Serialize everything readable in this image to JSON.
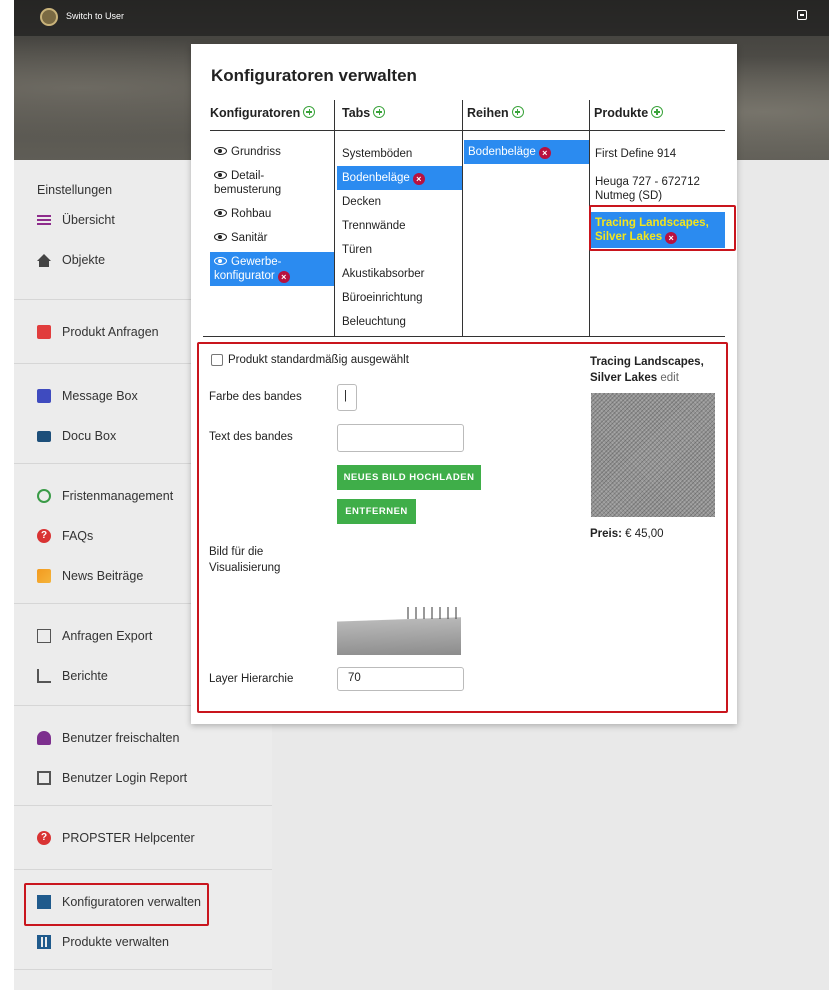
{
  "topbar": {
    "switch_label": "Switch to User"
  },
  "sidebar": {
    "settings_label": "Einstellungen",
    "groups": [
      [
        {
          "label": "Übersicht",
          "icon": "menu-icon"
        },
        {
          "label": "Objekte",
          "icon": "home-icon"
        }
      ],
      [
        {
          "label": "Produkt Anfragen",
          "icon": "list-icon"
        }
      ],
      [
        {
          "label": "Message Box",
          "icon": "message-icon"
        },
        {
          "label": "Docu Box",
          "icon": "folder-icon"
        }
      ],
      [
        {
          "label": "Fristenmanagement",
          "icon": "clock-icon"
        },
        {
          "label": "FAQs",
          "icon": "help-icon"
        },
        {
          "label": "News Beiträge",
          "icon": "rss-icon"
        }
      ],
      [
        {
          "label": "Anfragen Export",
          "icon": "export-icon"
        },
        {
          "label": "Berichte",
          "icon": "chart-icon"
        }
      ],
      [
        {
          "label": "Benutzer freischalten",
          "icon": "user-icon"
        },
        {
          "label": "Benutzer Login Report",
          "icon": "report-icon"
        }
      ],
      [
        {
          "label": "PROPSTER Helpcenter",
          "icon": "help-icon"
        }
      ],
      [
        {
          "label": "Konfiguratoren verwalten",
          "icon": "sitemap-icon"
        },
        {
          "label": "Produkte verwalten",
          "icon": "grid-icon"
        }
      ]
    ]
  },
  "panel": {
    "title": "Konfiguratoren verwalten",
    "columns": {
      "konfiguratoren": {
        "header": "Konfiguratoren",
        "items": [
          "Grundriss",
          "Detail-\nbemusterung",
          "Rohbau",
          "Sanitär",
          "Gewerbe-\nkonfigurator"
        ]
      },
      "tabs": {
        "header": "Tabs",
        "items": [
          "Systemböden",
          "Bodenbeläge",
          "Decken",
          "Trennwände",
          "Türen",
          "Akustikabsorber",
          "Büroeinrichtung",
          "Beleuchtung"
        ]
      },
      "reihen": {
        "header": "Reihen",
        "items": [
          "Bodenbeläge"
        ]
      },
      "produkte": {
        "header": "Produkte",
        "items": [
          "First Define 914",
          "Heuga 727 - 672712 Nutmeg (SD)",
          "Tracing Landscapes, Silver Lakes"
        ]
      }
    },
    "form": {
      "default_selected_label": "Produkt standardmäßig ausgewählt",
      "band_color_label": "Farbe des bandes",
      "band_color_value": "",
      "band_text_label": "Text des bandes",
      "band_text_value": "",
      "upload_button": "NEUES BILD HOCHLADEN",
      "remove_button": "ENTFERNEN",
      "visual_image_label": "Bild für die\nVisualisierung",
      "layer_label": "Layer Hierarchie",
      "layer_value": "70"
    },
    "product_info": {
      "name": "Tracing Landscapes, Silver Lakes",
      "edit_label": "edit",
      "price_label": "Preis:",
      "price_value": "€ 45,00"
    }
  },
  "colors": {
    "selection_blue": "#2b8bf0",
    "highlight_red": "#c9151d",
    "add_green": "#3aa33b",
    "button_green": "#3fae49",
    "selected_product_text": "#f3e51c"
  }
}
